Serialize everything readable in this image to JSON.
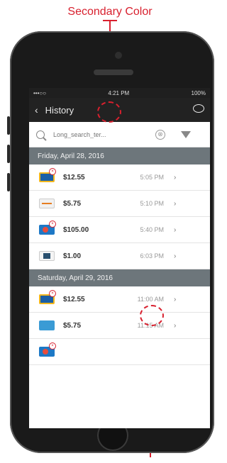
{
  "annotation": {
    "label": "Secondary Color",
    "color": "#d8202e"
  },
  "status": {
    "carrier": "•••○○",
    "time": "4:21 PM",
    "battery": "100%"
  },
  "nav": {
    "back": "‹",
    "title": "History"
  },
  "search": {
    "placeholder": "Long_search_ter...",
    "clear": "⊗"
  },
  "sections": [
    {
      "date": "Friday, April 28, 2016",
      "rows": [
        {
          "amount": "$12.55",
          "time": "5:05 PM"
        },
        {
          "amount": "$5.75",
          "time": "5:10 PM"
        },
        {
          "amount": "$105.00",
          "time": "5:40 PM"
        },
        {
          "amount": "$1.00",
          "time": "6:03 PM"
        }
      ]
    },
    {
      "date": "Saturday, April 29, 2016",
      "rows": [
        {
          "amount": "$12.55",
          "time": "11:00 AM"
        },
        {
          "amount": "$5.75",
          "time": "11:15 AM"
        }
      ]
    }
  ],
  "chevron": "›"
}
